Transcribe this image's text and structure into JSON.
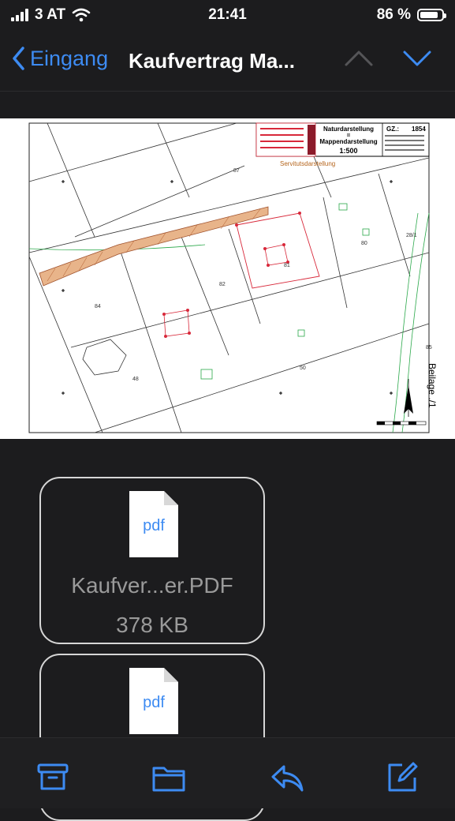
{
  "status": {
    "carrier": "3 AT",
    "time": "21:41",
    "battery": "86 %",
    "battery_level": 0.86
  },
  "nav": {
    "back_label": "Eingang",
    "title": "Kaufvertrag Ma..."
  },
  "plan": {
    "header_line1": "Naturdarstellung",
    "header_eq": "=",
    "header_line2": "Mappendarstellung",
    "scale": "1:500",
    "gz_label": "GZ.:",
    "gz_value": "1854",
    "servitut": "Servitutsdarstellung",
    "beilage": "Beilage ./1",
    "parcels": [
      "87",
      "84",
      "82",
      "81",
      "80",
      "50",
      "48",
      "28/1",
      "85"
    ]
  },
  "attachments": [
    {
      "type": "pdf",
      "name": "Kaufver...er.PDF",
      "size": "378 KB"
    },
    {
      "type": "pdf",
      "name": "",
      "size": ""
    }
  ],
  "colors": {
    "accent": "#3d8bf2",
    "background": "#1c1c1e"
  },
  "toolbar": {
    "icons": [
      "archive-icon",
      "folder-icon",
      "reply-icon",
      "compose-icon"
    ]
  }
}
